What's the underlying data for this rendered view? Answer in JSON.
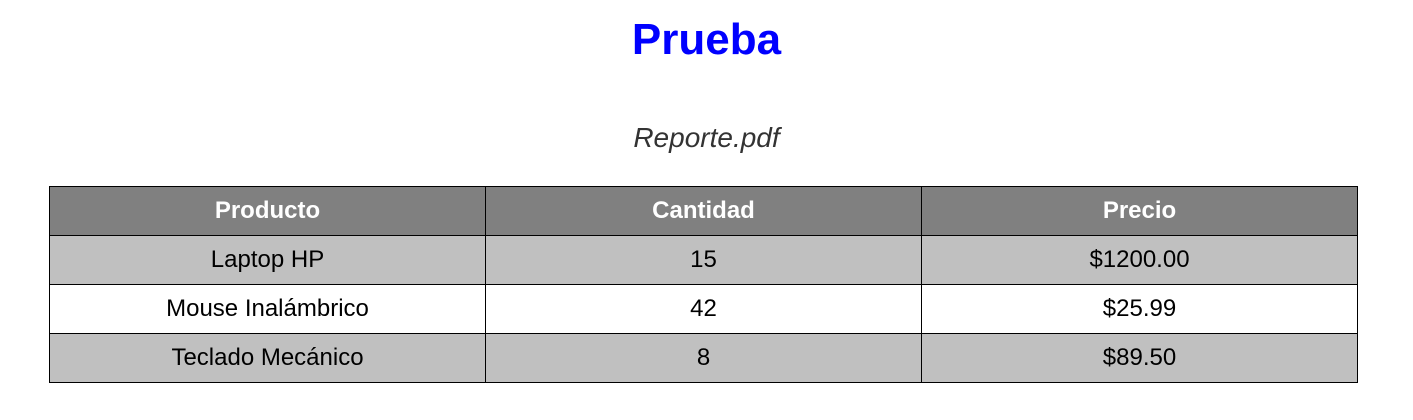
{
  "document": {
    "title": "Prueba",
    "filename": "Reporte.pdf",
    "title_color": "#0000ff"
  },
  "table": {
    "header_bg": "#808080",
    "shaded_row_bg": "#c0c0c0",
    "columns": [
      "Producto",
      "Cantidad",
      "Precio"
    ],
    "rows": [
      [
        "Laptop HP",
        "15",
        "$1200.00"
      ],
      [
        "Mouse Inalámbrico",
        "42",
        "$25.99"
      ],
      [
        "Teclado Mecánico",
        "8",
        "$89.50"
      ]
    ]
  }
}
